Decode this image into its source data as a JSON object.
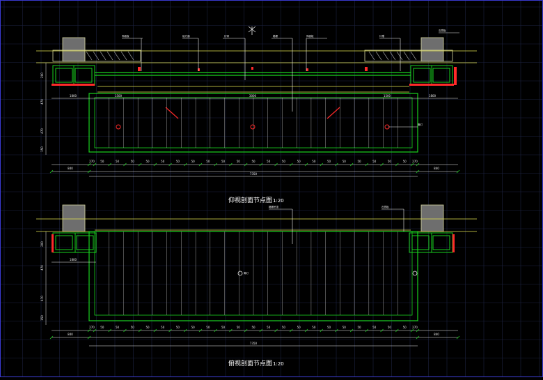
{
  "colors": {
    "background": "#000000",
    "grid": "#1d2240",
    "border": "#3a3ad0",
    "wall": "#d8d8a0",
    "green": "#19d21e",
    "yellow": "#e6e650",
    "white": "#f0f0f0",
    "red": "#ff2a2a",
    "hatch": "#8a8a8a"
  },
  "views": {
    "top": {
      "title": "仰视剖面节点图",
      "title_suffix": "1:20",
      "overall_dimension": "7350",
      "left_offset": "840",
      "right_offset": "840",
      "segment_labels": [
        "270",
        "50",
        "50",
        "50",
        "50",
        "50",
        "50",
        "50",
        "50",
        "50",
        "50",
        "50",
        "50",
        "50",
        "50",
        "50",
        "50",
        "50",
        "50",
        "50",
        "50",
        "50",
        "270"
      ],
      "upper_dimensions": [
        "1800",
        "1500",
        "3000",
        "1500",
        "1800"
      ],
      "vertical_dimensions": [
        "200",
        "470",
        "470",
        "150"
      ]
    },
    "bottom": {
      "title": "俯视剖面节点图",
      "title_suffix": "1:20",
      "overall_dimension": "7350",
      "left_offset": "840",
      "right_offset": "840",
      "segment_labels": [
        "270",
        "50",
        "50",
        "50",
        "50",
        "50",
        "50",
        "50",
        "50",
        "50",
        "50",
        "50",
        "50",
        "50",
        "50",
        "50",
        "50",
        "50",
        "50",
        "50",
        "50",
        "50",
        "270"
      ],
      "upper_dimensions": [
        "1800"
      ],
      "vertical_dimensions": [
        "200",
        "470",
        "470",
        "150"
      ]
    }
  }
}
